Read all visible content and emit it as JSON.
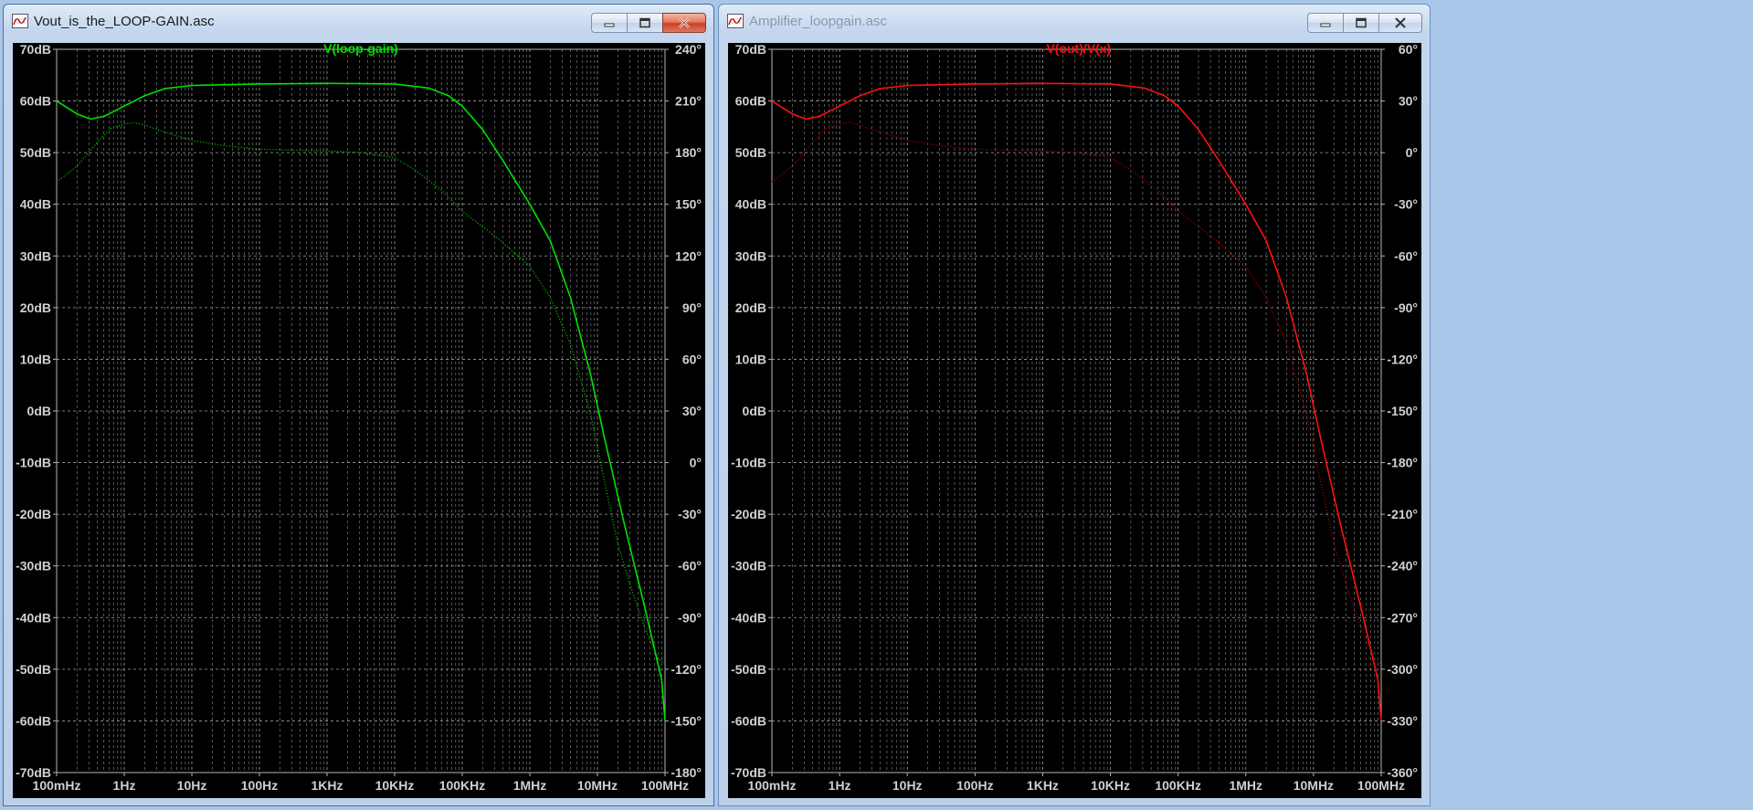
{
  "windows": [
    {
      "id": "left",
      "title": "Vout_is_the_LOOP-GAIN.asc",
      "active": true,
      "trace_label": "V(loop-gain)",
      "trace_color": "#00e000",
      "phase_color": "#00b400"
    },
    {
      "id": "right",
      "title": "Amplifier_loopgain.asc",
      "active": false,
      "trace_label": "-V(out)/V(x)",
      "trace_color": "#ff1010",
      "phase_color": "#a00000"
    }
  ],
  "chart_data": [
    {
      "type": "line",
      "title": "V(loop-gain)",
      "x_scale": "log",
      "xlim": [
        "100mHz",
        "100MHz"
      ],
      "x_ticks": [
        "100mHz",
        "1Hz",
        "10Hz",
        "100Hz",
        "1KHz",
        "10KHz",
        "100KHz",
        "1MHz",
        "10MHz",
        "100MHz"
      ],
      "y_left_ticks": [
        "70dB",
        "60dB",
        "50dB",
        "40dB",
        "30dB",
        "20dB",
        "10dB",
        "0dB",
        "-10dB",
        "-20dB",
        "-30dB",
        "-40dB",
        "-50dB",
        "-60dB",
        "-70dB"
      ],
      "y_right_ticks": [
        "240°",
        "210°",
        "180°",
        "150°",
        "120°",
        "90°",
        "60°",
        "30°",
        "0°",
        "-30°",
        "-60°",
        "-90°",
        "-120°",
        "-150°",
        "-180°"
      ],
      "ylim_left": [
        -70,
        70
      ],
      "ylim_right": [
        -180,
        240
      ],
      "grid": true,
      "x_decade_exponents": [
        -1,
        0,
        1,
        2,
        3,
        4,
        5,
        6,
        7,
        8
      ],
      "series": [
        {
          "name": "V(loop-gain)",
          "axis": "left",
          "style": "solid",
          "points": [
            [
              -1,
              60
            ],
            [
              -0.7,
              57.5
            ],
            [
              -0.5,
              56.5
            ],
            [
              -0.3,
              57.0
            ],
            [
              0,
              59.0
            ],
            [
              0.3,
              61.0
            ],
            [
              0.6,
              62.4
            ],
            [
              1,
              63.0
            ],
            [
              2,
              63.3
            ],
            [
              3,
              63.4
            ],
            [
              4,
              63.3
            ],
            [
              4.5,
              62.5
            ],
            [
              4.8,
              61.0
            ],
            [
              5,
              59.0
            ],
            [
              5.3,
              54.5
            ],
            [
              5.6,
              48.5
            ],
            [
              6,
              40.0
            ],
            [
              6.3,
              33.0
            ],
            [
              6.6,
              22.0
            ],
            [
              6.9,
              7.0
            ],
            [
              7.1,
              -5.0
            ],
            [
              7.4,
              -22.0
            ],
            [
              7.7,
              -38.0
            ],
            [
              7.95,
              -52.0
            ],
            [
              8,
              -60.0
            ]
          ]
        },
        {
          "name": "phase",
          "axis": "right",
          "style": "dotted",
          "points": [
            [
              -1,
              163
            ],
            [
              -0.7,
              172
            ],
            [
              -0.4,
              186
            ],
            [
              -0.2,
              194
            ],
            [
              0,
              196.5
            ],
            [
              0.15,
              197.5
            ],
            [
              0.3,
              196
            ],
            [
              0.6,
              192
            ],
            [
              1,
              187
            ],
            [
              1.5,
              184
            ],
            [
              2,
              182
            ],
            [
              3,
              181
            ],
            [
              3.5,
              180
            ],
            [
              4,
              177
            ],
            [
              4.3,
              170
            ],
            [
              4.7,
              158
            ],
            [
              5,
              146
            ],
            [
              5.5,
              131
            ],
            [
              6,
              114
            ],
            [
              6.3,
              96
            ],
            [
              6.6,
              69
            ],
            [
              6.9,
              28
            ],
            [
              7.1,
              -10
            ],
            [
              7.3,
              -47
            ],
            [
              7.5,
              -73
            ],
            [
              7.7,
              -96
            ],
            [
              7.9,
              -114
            ],
            [
              8,
              -117
            ]
          ]
        }
      ]
    },
    {
      "type": "line",
      "title": "-V(out)/V(x)",
      "x_scale": "log",
      "xlim": [
        "100mHz",
        "100MHz"
      ],
      "x_ticks": [
        "100mHz",
        "1Hz",
        "10Hz",
        "100Hz",
        "1KHz",
        "10KHz",
        "100KHz",
        "1MHz",
        "10MHz",
        "100MHz"
      ],
      "y_left_ticks": [
        "70dB",
        "60dB",
        "50dB",
        "40dB",
        "30dB",
        "20dB",
        "10dB",
        "0dB",
        "-10dB",
        "-20dB",
        "-30dB",
        "-40dB",
        "-50dB",
        "-60dB",
        "-70dB"
      ],
      "y_right_ticks": [
        "60°",
        "30°",
        "0°",
        "-30°",
        "-60°",
        "-90°",
        "-120°",
        "-150°",
        "-180°",
        "-210°",
        "-240°",
        "-270°",
        "-300°",
        "-330°",
        "-360°"
      ],
      "ylim_left": [
        -70,
        70
      ],
      "ylim_right": [
        -360,
        60
      ],
      "grid": true,
      "x_decade_exponents": [
        -1,
        0,
        1,
        2,
        3,
        4,
        5,
        6,
        7,
        8
      ],
      "series": [
        {
          "name": "-V(out)/V(x)",
          "axis": "left",
          "style": "solid",
          "points": [
            [
              -1,
              60
            ],
            [
              -0.7,
              57.5
            ],
            [
              -0.5,
              56.5
            ],
            [
              -0.3,
              57.0
            ],
            [
              0,
              59.0
            ],
            [
              0.3,
              61.0
            ],
            [
              0.6,
              62.4
            ],
            [
              1,
              63.0
            ],
            [
              2,
              63.3
            ],
            [
              3,
              63.4
            ],
            [
              4,
              63.3
            ],
            [
              4.5,
              62.5
            ],
            [
              4.8,
              61.0
            ],
            [
              5,
              59.0
            ],
            [
              5.3,
              54.5
            ],
            [
              5.6,
              48.5
            ],
            [
              6,
              40.0
            ],
            [
              6.3,
              33.0
            ],
            [
              6.6,
              22.0
            ],
            [
              6.9,
              7.0
            ],
            [
              7.1,
              -5.0
            ],
            [
              7.4,
              -22.0
            ],
            [
              7.7,
              -38.0
            ],
            [
              7.95,
              -52.0
            ],
            [
              8,
              -60.0
            ]
          ]
        },
        {
          "name": "phase",
          "axis": "right",
          "style": "dotted",
          "points": [
            [
              -1,
              -17
            ],
            [
              -0.7,
              -8
            ],
            [
              -0.4,
              6
            ],
            [
              -0.2,
              14
            ],
            [
              0,
              16.5
            ],
            [
              0.15,
              17.5
            ],
            [
              0.3,
              16
            ],
            [
              0.6,
              12
            ],
            [
              1,
              7
            ],
            [
              1.5,
              4
            ],
            [
              2,
              2
            ],
            [
              3,
              1
            ],
            [
              3.5,
              0
            ],
            [
              4,
              -3
            ],
            [
              4.3,
              -10
            ],
            [
              4.7,
              -22
            ],
            [
              5,
              -34
            ],
            [
              5.5,
              -49
            ],
            [
              6,
              -66
            ],
            [
              6.3,
              -84
            ],
            [
              6.6,
              -111
            ],
            [
              6.9,
              -152
            ],
            [
              7.1,
              -190
            ],
            [
              7.3,
              -227
            ],
            [
              7.5,
              -253
            ],
            [
              7.7,
              -276
            ],
            [
              7.9,
              -294
            ],
            [
              8,
              -297
            ]
          ]
        }
      ]
    }
  ]
}
